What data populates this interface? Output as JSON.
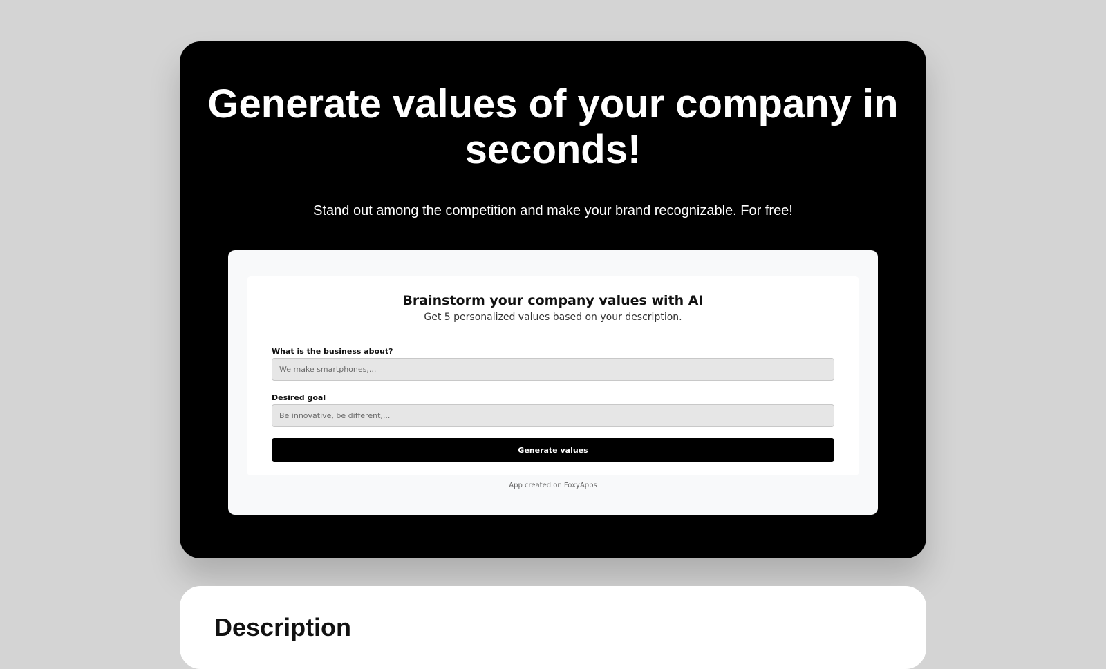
{
  "hero": {
    "title": "Generate values of your company in seconds!",
    "subtitle": "Stand out among the competition and make your brand recognizable. For free!"
  },
  "app": {
    "title": "Brainstorm your company values with AI",
    "subtitle": "Get 5 personalized values based on your description.",
    "fields": [
      {
        "label": "What is the business about?",
        "placeholder": "We make smartphones,..."
      },
      {
        "label": "Desired goal",
        "placeholder": "Be innovative, be different,..."
      }
    ],
    "button_label": "Generate values",
    "footer": "App created on FoxyApps"
  },
  "description": {
    "heading": "Description"
  },
  "colors": {
    "page_background": "#d4d4d4",
    "hero_background": "#000000",
    "button_background": "#000000",
    "input_background": "#e6e6e6"
  }
}
